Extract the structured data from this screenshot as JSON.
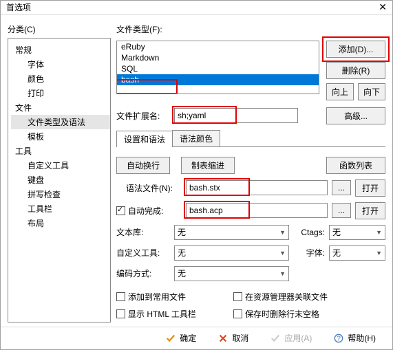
{
  "window": {
    "title": "首选项",
    "close": "✕"
  },
  "left": {
    "label": "分类(C)",
    "items": [
      {
        "label": "常规",
        "level": 0
      },
      {
        "label": "字体",
        "level": 1
      },
      {
        "label": "颜色",
        "level": 1
      },
      {
        "label": "打印",
        "level": 1
      },
      {
        "label": "文件",
        "level": 0
      },
      {
        "label": "文件类型及语法",
        "level": 1,
        "selected": true
      },
      {
        "label": "模板",
        "level": 1
      },
      {
        "label": "工具",
        "level": 0
      },
      {
        "label": "自定义工具",
        "level": 1
      },
      {
        "label": "键盘",
        "level": 1
      },
      {
        "label": "拼写检查",
        "level": 1
      },
      {
        "label": "工具栏",
        "level": 1
      },
      {
        "label": "布局",
        "level": 1
      }
    ]
  },
  "right": {
    "filetype_label": "文件类型(F):",
    "filetypes": [
      "eRuby",
      "Markdown",
      "SQL",
      "bash"
    ],
    "selected_index": 3,
    "buttons": {
      "add": "添加(D)...",
      "delete": "删除(R)",
      "up": "向上",
      "down": "向下",
      "advanced": "高级..."
    },
    "ext_label": "文件扩展名:",
    "ext_value": "sh;yaml",
    "tabs": {
      "t1": "设置和语法",
      "t2": "语法颜色",
      "active": 0
    },
    "pane": {
      "auto_wrap": "自动换行",
      "tab_indent": "制表缩进",
      "func_list": "函数列表",
      "syntax_file_label": "语法文件(N):",
      "syntax_file": "bash.stx",
      "autocomplete_label": "自动完成:",
      "autocomplete_checked": true,
      "autocomplete_file": "bash.acp",
      "browse": "...",
      "open": "打开",
      "textlib_label": "文本库:",
      "ctags_label": "Ctags:",
      "customtool_label": "自定义工具:",
      "font_label": "字体:",
      "encoding_label": "编码方式:",
      "none": "无",
      "cb1": "添加到常用文件",
      "cb2": "在资源管理器关联文件",
      "cb3": "显示 HTML 工具栏",
      "cb4": "保存时删除行末空格"
    }
  },
  "footer": {
    "ok": "确定",
    "cancel": "取消",
    "apply": "应用(A)",
    "help": "帮助(H)"
  }
}
